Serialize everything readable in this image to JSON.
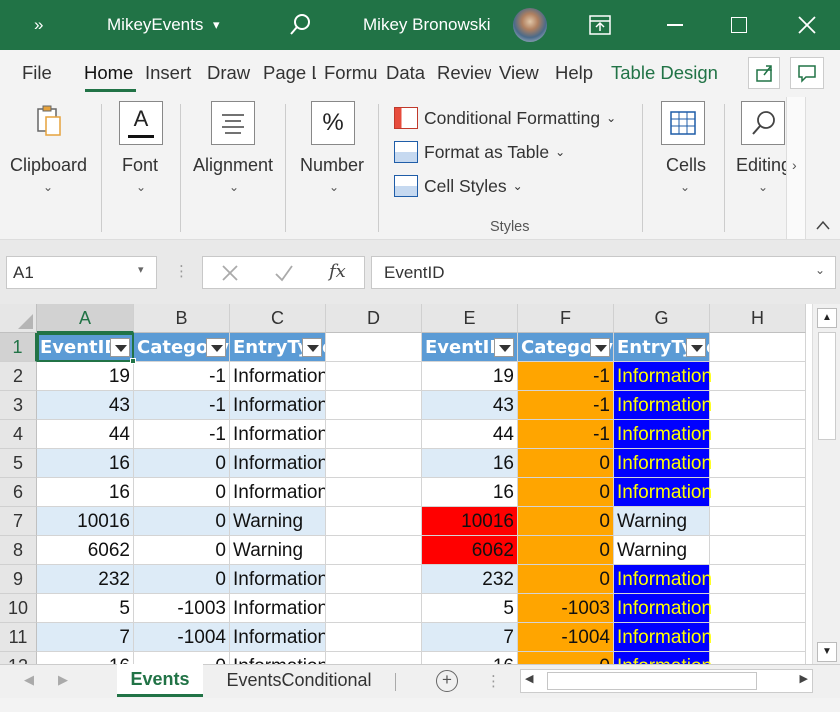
{
  "title": {
    "quick": "»",
    "doc": "MikeyEvents",
    "caret": "▾",
    "user": "Mikey Bronowski"
  },
  "tabs": [
    "File",
    "Home",
    "Insert",
    "Draw",
    "Page L",
    "Formu",
    "Data",
    "Review",
    "View",
    "Help",
    "Table Design"
  ],
  "ribbon": {
    "clipboard": "Clipboard",
    "font": "Font",
    "alignment": "Alignment",
    "number": "Number",
    "cond": "Conditional Formatting",
    "fat": "Format as Table",
    "cellstyles": "Cell Styles",
    "styles": "Styles",
    "cells": "Cells",
    "editing": "Editing",
    "font_glyph": "A",
    "number_glyph": "%"
  },
  "formula": {
    "namebox": "A1",
    "fx": "fx",
    "content": "EventID"
  },
  "columns": [
    "A",
    "B",
    "C",
    "D",
    "E",
    "F",
    "G",
    "H"
  ],
  "rows": [
    "1",
    "2",
    "3",
    "4",
    "5",
    "6",
    "7",
    "8",
    "9",
    "10",
    "11",
    "12"
  ],
  "headers": [
    "EventID",
    "Category",
    "EntryType"
  ],
  "table": [
    [
      "19",
      "-1",
      "Information"
    ],
    [
      "43",
      "-1",
      "Information"
    ],
    [
      "44",
      "-1",
      "Information"
    ],
    [
      "16",
      "0",
      "Information"
    ],
    [
      "16",
      "0",
      "Information"
    ],
    [
      "10016",
      "0",
      "Warning"
    ],
    [
      "6062",
      "0",
      "Warning"
    ],
    [
      "232",
      "0",
      "Information"
    ],
    [
      "5",
      "-1003",
      "Information"
    ],
    [
      "7",
      "-1004",
      "Information"
    ],
    [
      "16",
      "0",
      "Information"
    ]
  ],
  "sheets": [
    "Events",
    "EventsConditional"
  ],
  "colors": {
    "excel_green": "#217346",
    "table_header": "#5b9bd5",
    "band": "#ddebf7",
    "orange": "#ffa500",
    "red": "#ff0000",
    "blue": "#0000ff",
    "yellow": "#ffff00"
  }
}
